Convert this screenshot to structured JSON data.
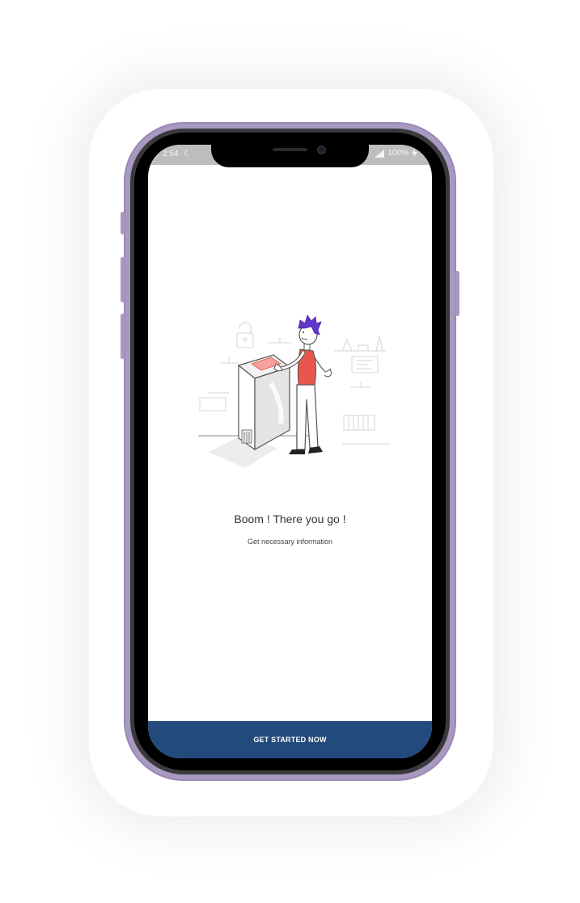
{
  "status_bar": {
    "time": "2:54",
    "dnd_icon": "moon-icon",
    "signal_icon": "signal-icon",
    "battery_text": "100%",
    "charging_icon": "bolt-icon"
  },
  "onboarding": {
    "illustration": "person-at-voting-machine-illustration",
    "title": "Boom ! There you go !",
    "subtitle": "Get necessary information",
    "cta_label": "GET STARTED NOW"
  },
  "colors": {
    "device_frame": "#a899c0",
    "cta_background": "#234a7c",
    "status_bar": "#bdbdbd",
    "accent_red": "#e8574d",
    "hair_purple": "#6236c8"
  }
}
